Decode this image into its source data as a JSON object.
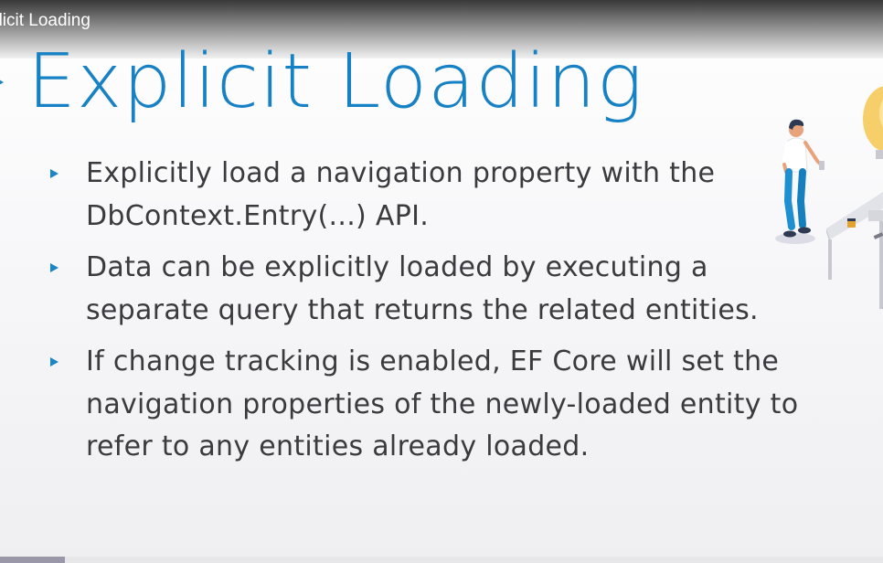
{
  "video": {
    "title": "plicit Loading"
  },
  "slide": {
    "title": "Explicit Loading",
    "bullets": [
      {
        "text": "Explicitly load a navigation property with the DbContext.Entry(...) API."
      },
      {
        "text": "Data can be explicitly loaded by executing a separate query that returns the related entities."
      },
      {
        "text": "If change tracking is enabled, EF Core will set the navigation properties of the newly-loaded entity to refer to any entities already loaded."
      }
    ]
  },
  "illustration": {
    "name": "person-at-desk-lightbulb-illustration"
  },
  "progress": {
    "fraction": 0.074
  },
  "colors": {
    "accent": "#1681c4",
    "body_text": "#3a3a3f",
    "progress": "#9a98a8"
  }
}
